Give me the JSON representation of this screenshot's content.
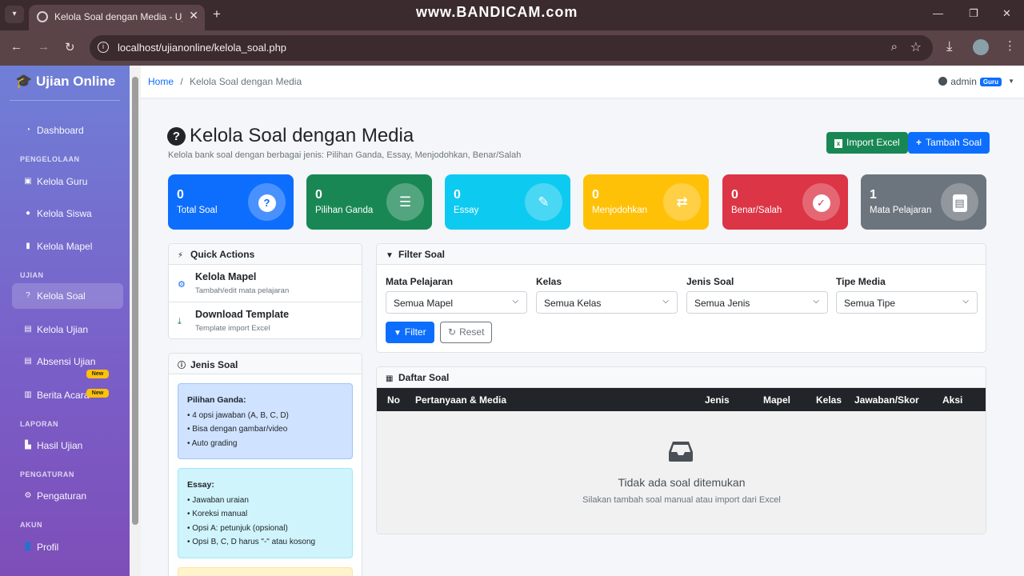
{
  "browser": {
    "tab_title": "Kelola Soal dengan Media - Ujian",
    "url": "localhost/ujianonline/kelola_soal.php",
    "watermark": "www.BANDICAM.com"
  },
  "sidebar": {
    "brand": "Ujian Online",
    "sections": {
      "pengelolaan": "PENGELOLAAN",
      "ujian": "UJIAN",
      "laporan": "LAPORAN",
      "pengaturan": "PENGATURAN",
      "akun": "AKUN"
    },
    "items": {
      "dashboard": "Dashboard",
      "kelola_guru": "Kelola Guru",
      "kelola_siswa": "Kelola Siswa",
      "kelola_mapel": "Kelola Mapel",
      "kelola_soal": "Kelola Soal",
      "kelola_ujian": "Kelola Ujian",
      "absensi_ujian": "Absensi Ujian",
      "berita_acara": "Berita Acara",
      "hasil_ujian": "Hasil Ujian",
      "pengaturan": "Pengaturan",
      "profil": "Profil"
    },
    "new_badge": "New"
  },
  "topnav": {
    "breadcrumb_home": "Home",
    "breadcrumb_sep": "/",
    "breadcrumb_current": "Kelola Soal dengan Media",
    "user": "admin",
    "role": "Guru"
  },
  "page": {
    "title": "Kelola Soal dengan Media",
    "subtitle": "Kelola bank soal dengan berbagai jenis: Pilihan Ganda, Essay, Menjodohkan, Benar/Salah",
    "import_button": "Import Excel",
    "add_button": "Tambah Soal"
  },
  "stats": [
    {
      "value": "0",
      "label": "Total Soal",
      "color": "#0d6efd"
    },
    {
      "value": "0",
      "label": "Pilihan Ganda",
      "color": "#198754"
    },
    {
      "value": "0",
      "label": "Essay",
      "color": "#0dcaf0"
    },
    {
      "value": "0",
      "label": "Menjodohkan",
      "color": "#ffc107"
    },
    {
      "value": "0",
      "label": "Benar/Salah",
      "color": "#dc3545"
    },
    {
      "value": "1",
      "label": "Mata Pelajaran",
      "color": "#6c757d"
    }
  ],
  "quick_actions": {
    "title": "Quick Actions",
    "items": [
      {
        "title": "Kelola Mapel",
        "subtitle": "Tambah/edit mata pelajaran"
      },
      {
        "title": "Download Template",
        "subtitle": "Template import Excel"
      }
    ]
  },
  "jenis_soal": {
    "title": "Jenis Soal",
    "pg_title": "Pilihan Ganda:",
    "pg_1": "• 4 opsi jawaban (A, B, C, D)",
    "pg_2": "• Bisa dengan gambar/video",
    "pg_3": "• Auto grading",
    "essay_title": "Essay:",
    "essay_1": "• Jawaban uraian",
    "essay_2": "• Koreksi manual",
    "essay_3": "• Opsi A: petunjuk (opsional)",
    "essay_4": "• Opsi B, C, D harus \"-\" atau kosong"
  },
  "filter": {
    "title": "Filter Soal",
    "mapel_label": "Mata Pelajaran",
    "mapel_value": "Semua Mapel",
    "kelas_label": "Kelas",
    "kelas_value": "Semua Kelas",
    "jenis_label": "Jenis Soal",
    "jenis_value": "Semua Jenis",
    "tipe_label": "Tipe Media",
    "tipe_value": "Semua Tipe",
    "filter_button": "Filter",
    "reset_button": "Reset"
  },
  "daftar": {
    "title": "Daftar Soal",
    "columns": [
      "No",
      "Pertanyaan & Media",
      "Jenis",
      "Mapel",
      "Kelas",
      "Jawaban/Skor",
      "Aksi"
    ],
    "empty_title": "Tidak ada soal ditemukan",
    "empty_subtitle": "Silakan tambah soal manual atau import dari Excel"
  }
}
